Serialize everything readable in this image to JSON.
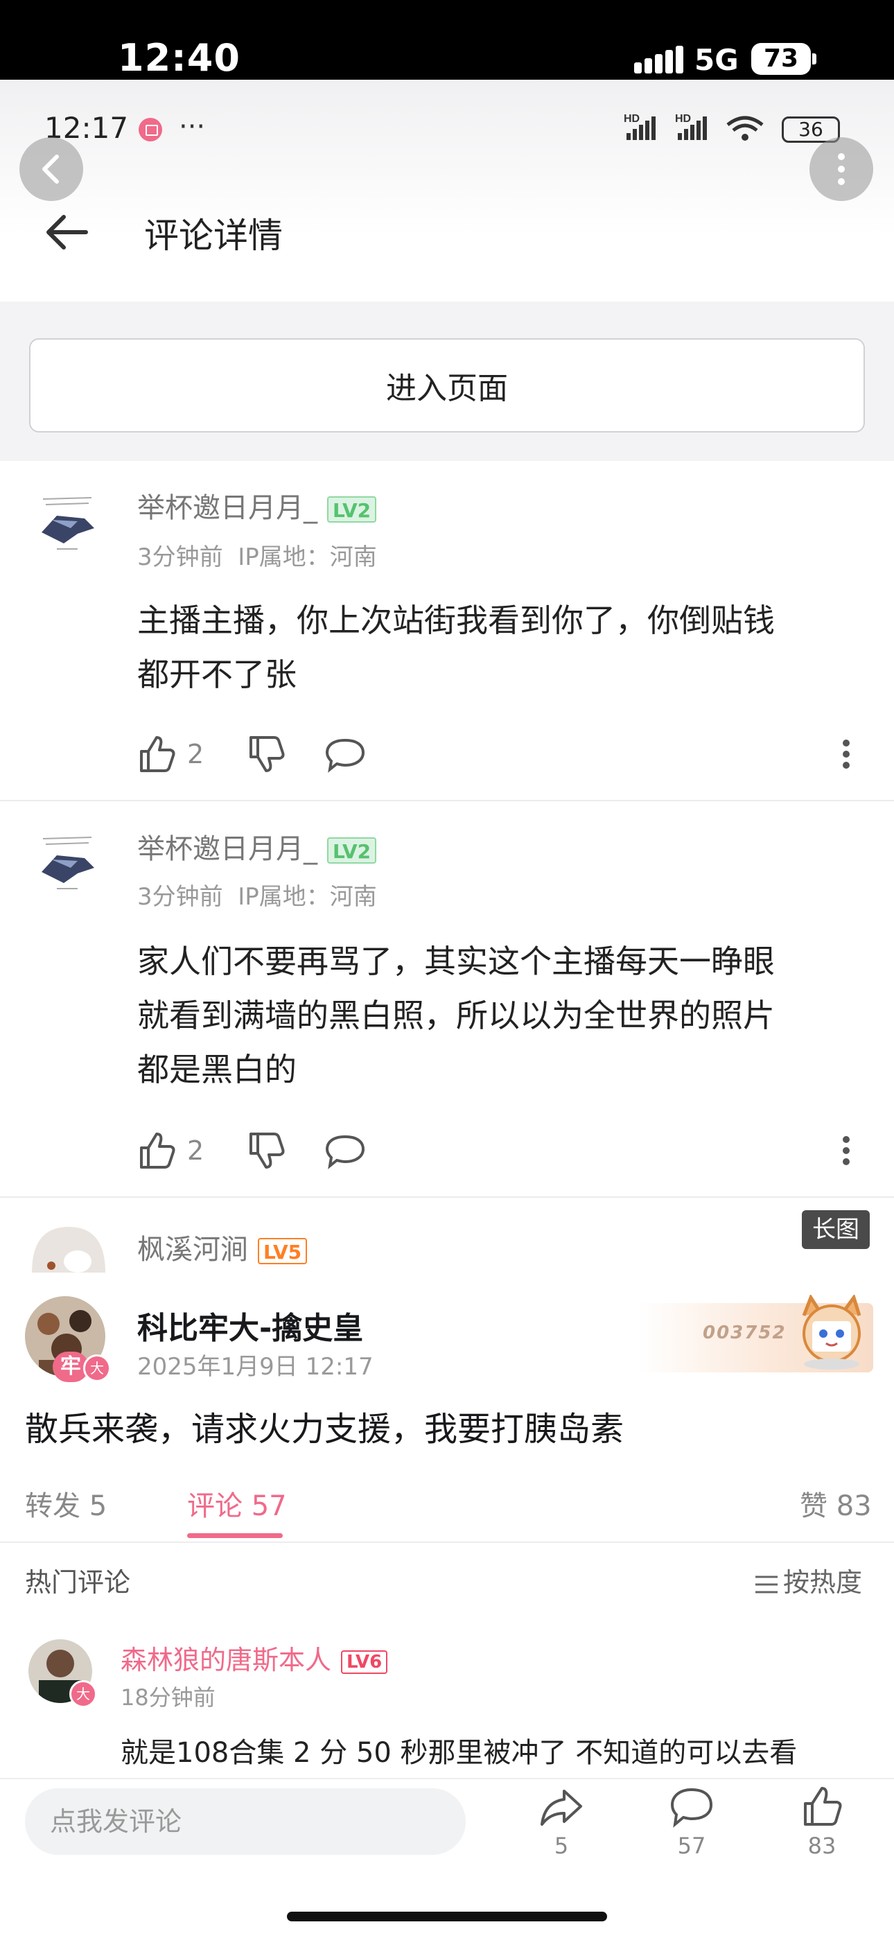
{
  "outer_status": {
    "time": "12:40",
    "network": "5G",
    "battery": "73"
  },
  "inner_status": {
    "time": "12:17",
    "more": "···",
    "signal": "HD",
    "battery": "36"
  },
  "header": {
    "title": "评论详情"
  },
  "enter_page_button": "进入页面",
  "replies": [
    {
      "user": "举杯邀日月月_",
      "level": "LV2",
      "time": "3分钟前",
      "ip": "IP属地：河南",
      "text_lines": [
        "主播主播，你上次站街我看到你了，你倒贴钱",
        "都开不了张"
      ],
      "likes": "2"
    },
    {
      "user": "举杯邀日月月_",
      "level": "LV2",
      "time": "3分钟前",
      "ip": "IP属地：河南",
      "text_lines": [
        "家人们不要再骂了，其实这个主播每天一睁眼",
        "就看到满墙的黑白照，所以以为全世界的照片",
        "都是黑白的"
      ],
      "likes": "2"
    }
  ],
  "partial_user": {
    "name": "枫溪河涧",
    "level": "LV5"
  },
  "long_image_badge": "长图",
  "post": {
    "author": "科比牢大-擒史皇",
    "date": "2025年1月9日 12:17",
    "badge_number": "003752",
    "avatar_badge": "牢",
    "text": "散兵来袭，请求火力支援，我要打胰岛素"
  },
  "tabs": {
    "forward": "转发 5",
    "comments": "评论 57",
    "likes": "赞 83"
  },
  "hot_section": {
    "title": "热门评论",
    "sort": "按热度"
  },
  "hot_comment": {
    "user": "森林狼的唐斯本人",
    "level": "LV6",
    "time": "18分钟前",
    "text": "就是108合集 2 分 50 秒那里被冲了 不知道的可以去看"
  },
  "bottom": {
    "placeholder": "点我发评论",
    "share_count": "5",
    "comment_count": "57",
    "like_count": "83"
  },
  "colors": {
    "accent": "#f06a8a",
    "level_green": "#56c26e",
    "level_orange": "#ff7f24"
  }
}
